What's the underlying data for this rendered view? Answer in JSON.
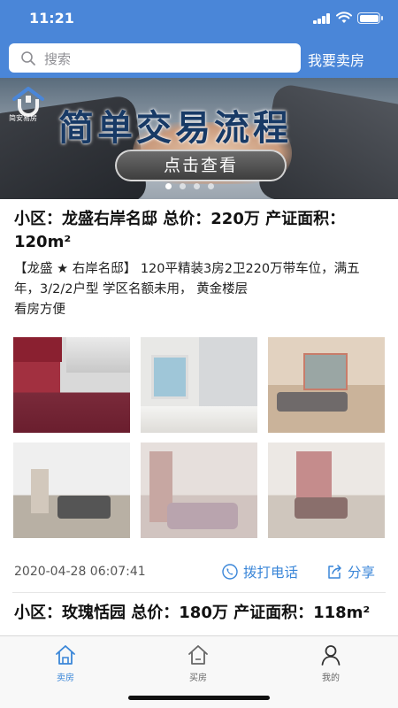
{
  "status_bar": {
    "time": "11:21"
  },
  "search": {
    "placeholder": "搜索",
    "sell_link": "我要卖房"
  },
  "banner": {
    "logo_text": "简安易房",
    "title": "简单交易流程",
    "button": "点击查看",
    "slide_count": 4,
    "active_slide": 1
  },
  "listings": [
    {
      "title": "小区：龙盛右岸名邸 总价：220万 产证面积：120m²",
      "description": "【龙盛 ★ 右岸名邸】 120平精装3房2卫220万带车位，满五年，3/2/2户型 学区名额未用， 黄金楼层\n看房方便",
      "photos": [
        "kitchen",
        "bathroom",
        "living-room",
        "dining-room",
        "bedroom",
        "living-room-2"
      ],
      "timestamp": "2020-04-28 06:07:41",
      "call_label": "拨打电话",
      "share_label": "分享"
    },
    {
      "title": "小区：玫瑰恬园 总价：180万 产证面积：118m²"
    }
  ],
  "tabbar": {
    "items": [
      {
        "label": "卖房",
        "icon": "home-icon",
        "active": true
      },
      {
        "label": "买房",
        "icon": "house-icon",
        "active": false
      },
      {
        "label": "我的",
        "icon": "user-icon",
        "active": false
      }
    ]
  },
  "colors": {
    "primary": "#4a86d8",
    "accent": "#3a86d8",
    "banner_title": "#183a66"
  }
}
